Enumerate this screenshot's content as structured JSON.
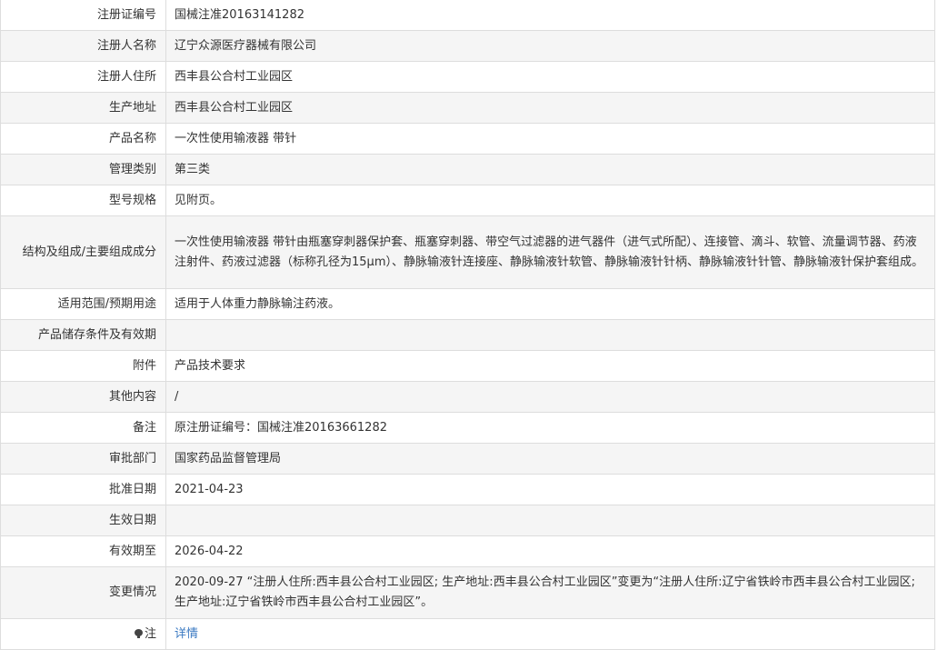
{
  "rows": [
    {
      "label": "注册证编号",
      "value": "国械注准20163141282"
    },
    {
      "label": "注册人名称",
      "value": "辽宁众源医疗器械有限公司"
    },
    {
      "label": "注册人住所",
      "value": "西丰县公合村工业园区"
    },
    {
      "label": "生产地址",
      "value": "西丰县公合村工业园区"
    },
    {
      "label": "产品名称",
      "value": "一次性使用输液器 带针"
    },
    {
      "label": "管理类别",
      "value": "第三类"
    },
    {
      "label": "型号规格",
      "value": "见附页。"
    },
    {
      "label": "结构及组成/主要组成成分",
      "value": "一次性使用输液器 带针由瓶塞穿刺器保护套、瓶塞穿刺器、带空气过滤器的进气器件（进气式所配）、连接管、滴斗、软管、流量调节器、药液注射件、药液过滤器（标称孔径为15μm）、静脉输液针连接座、静脉输液针软管、静脉输液针针柄、静脉输液针针管、静脉输液针保护套组成。"
    },
    {
      "label": "适用范围/预期用途",
      "value": "适用于人体重力静脉输注药液。"
    },
    {
      "label": "产品储存条件及有效期",
      "value": ""
    },
    {
      "label": "附件",
      "value": "产品技术要求"
    },
    {
      "label": "其他内容",
      "value": "/"
    },
    {
      "label": "备注",
      "value": "原注册证编号：国械注准20163661282"
    },
    {
      "label": "审批部门",
      "value": "国家药品监督管理局"
    },
    {
      "label": "批准日期",
      "value": "2021-04-23"
    },
    {
      "label": "生效日期",
      "value": ""
    },
    {
      "label": "有效期至",
      "value": "2026-04-22"
    },
    {
      "label": "变更情况",
      "value": "2020-09-27 “注册人住所:西丰县公合村工业园区; 生产地址:西丰县公合村工业园区”变更为“注册人住所:辽宁省铁岭市西丰县公合村工业园区; 生产地址:辽宁省铁岭市西丰县公合村工业园区”。"
    }
  ],
  "note": {
    "label": "注",
    "link_text": "详情",
    "icon": "lightbulb-icon"
  },
  "colors": {
    "border": "#dddddd",
    "alt_row": "#f5f5f5",
    "link": "#3a79c2"
  }
}
